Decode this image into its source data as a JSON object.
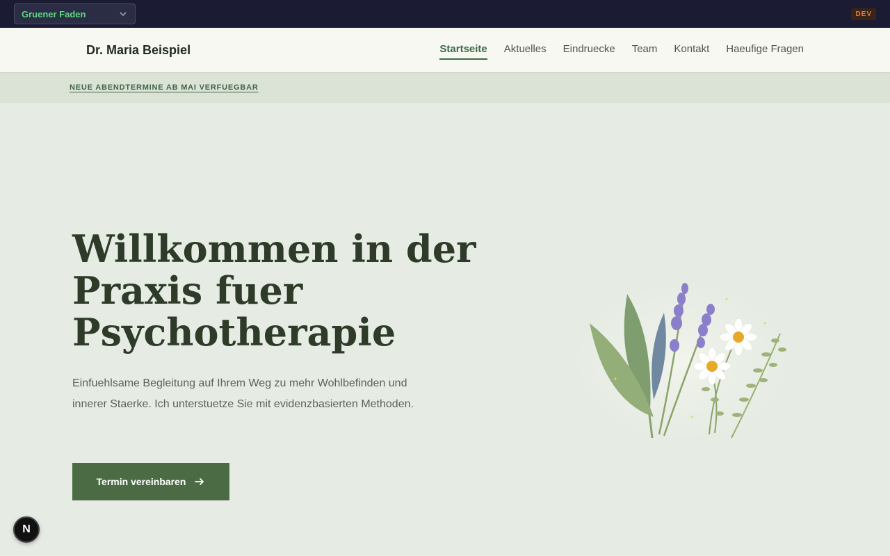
{
  "devbar": {
    "theme_select": {
      "value": "Gruener Faden"
    },
    "env_badge": "DEV"
  },
  "header": {
    "brand": "Dr. Maria Beispiel",
    "nav": [
      {
        "label": "Startseite",
        "active": true
      },
      {
        "label": "Aktuelles",
        "active": false
      },
      {
        "label": "Eindruecke",
        "active": false
      },
      {
        "label": "Team",
        "active": false
      },
      {
        "label": "Kontakt",
        "active": false
      },
      {
        "label": "Haeufige Fragen",
        "active": false
      }
    ]
  },
  "announcement": {
    "text": "NEUE ABENDTERMINE AB MAI VERFUEGBAR"
  },
  "hero": {
    "title": "Willkommen in der Praxis fuer Psychotherapie",
    "text": "Einfuehlsame Begleitung auf Ihrem Weg zu mehr Wohlbefinden und innerer Staerke. Ich unterstuetze Sie mit evidenzbasierten Methoden.",
    "cta_label": "Termin vereinbaren",
    "cta_icon": "arrow-right-icon",
    "illustration": "herb-bouquet-illustration"
  },
  "dev_indicator": {
    "label": "N"
  },
  "colors": {
    "primary": "#4b6b44",
    "nav_active": "#3c6a43",
    "hero_bg": "#e6ece4",
    "topbar_bg": "#1b1b33"
  }
}
